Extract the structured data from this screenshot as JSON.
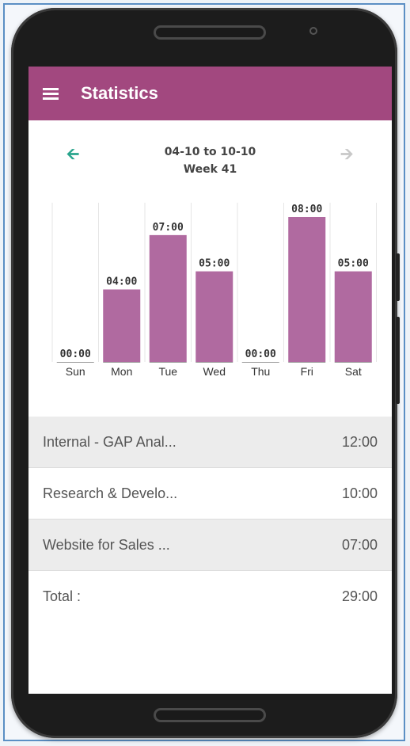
{
  "app": {
    "title": "Statistics"
  },
  "week": {
    "range": "04-10 to 10-10",
    "label": "Week 41"
  },
  "icons": {
    "menu": "hamburger-menu-icon",
    "prev": "arrow-left-icon",
    "next": "arrow-right-icon"
  },
  "colors": {
    "brand": "#a2487f",
    "bar": "#b06aa0",
    "prev_arrow": "#2aa58d",
    "next_arrow_disabled": "#c8c8c8"
  },
  "chart_data": {
    "type": "bar",
    "categories": [
      "Sun",
      "Mon",
      "Tue",
      "Wed",
      "Thu",
      "Fri",
      "Sat"
    ],
    "values": [
      0,
      4,
      7,
      5,
      0,
      8,
      5
    ],
    "value_labels": [
      "00:00",
      "04:00",
      "07:00",
      "05:00",
      "00:00",
      "08:00",
      "05:00"
    ],
    "ylim": [
      0,
      8
    ]
  },
  "projects": [
    {
      "name": "Internal - GAP Anal...",
      "hours": "12:00"
    },
    {
      "name": "Research & Develo...",
      "hours": "10:00"
    },
    {
      "name": "Website for Sales ...",
      "hours": "07:00"
    }
  ],
  "total": {
    "label": "Total :",
    "hours": "29:00"
  }
}
